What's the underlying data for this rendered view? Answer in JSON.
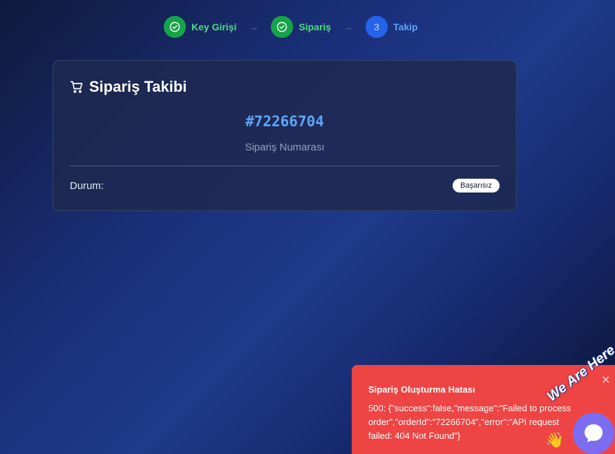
{
  "steps": [
    {
      "label": "Key Girişi",
      "state": "done",
      "icon": "check-circle-icon"
    },
    {
      "label": "Sipariş",
      "state": "done",
      "icon": "check-circle-icon"
    },
    {
      "label": "Takip",
      "state": "active",
      "number": "3"
    }
  ],
  "card": {
    "title": "Sipariş Takibi",
    "title_icon": "shopping-cart-icon",
    "order_number": "#72266704",
    "order_number_label": "Sipariş Numarası",
    "status_label": "Durum:",
    "status_value": "Başarısız"
  },
  "toast": {
    "title": "Sipariş Oluşturma Hatası",
    "message": "500: {\"success\":false,\"message\":\"Failed to process order\",\"orderId\":\"72266704\",\"error\":\"API request failed: 404 Not Found\"}",
    "close_icon": "close-icon"
  },
  "chat": {
    "text": "We Are Here",
    "wave_icon": "waving-hand-icon",
    "button_icon": "chat-bubble-icon",
    "accent": "#7c6cf0"
  },
  "colors": {
    "success": "#16a34a",
    "active": "#2563eb",
    "error": "#ef4444",
    "order_number": "#60a5fa"
  }
}
